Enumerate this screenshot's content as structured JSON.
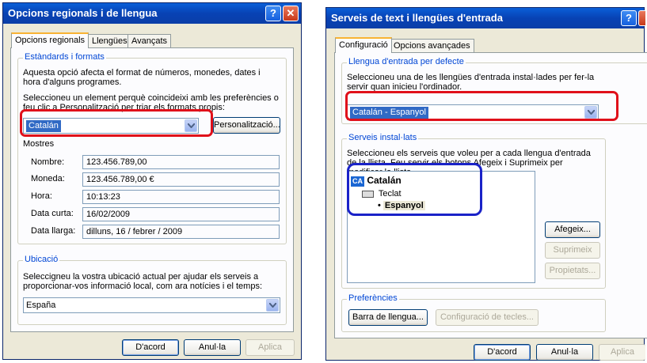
{
  "left_dialog": {
    "title": "Opcions regionals i de llengua",
    "help_glyph": "?",
    "close_glyph": "✕",
    "tabs": [
      "Opcions regionals",
      "Llengües",
      "Avançats"
    ],
    "standards_group": {
      "title": "Estàndards i formats",
      "desc": "Aquesta opció afecta el format de números, monedes, dates i hora d'alguns programes.",
      "instr": "Seleccioneu un element perquè coincideixi amb les preferències o feu clic a Personalització per triar els formats propis:",
      "format_value": "Catalán",
      "customize_label": "Personalització...",
      "samples_label": "Mostres",
      "samples": [
        {
          "label": "Nombre:",
          "value": "123.456.789,00"
        },
        {
          "label": "Moneda:",
          "value": "123.456.789,00 €"
        },
        {
          "label": "Hora:",
          "value": "10:13:23"
        },
        {
          "label": "Data curta:",
          "value": "16/02/2009"
        },
        {
          "label": "Data llarga:",
          "value": "dilluns, 16 / febrer / 2009"
        }
      ]
    },
    "location_group": {
      "title": "Ubicació",
      "desc": "Seleccigneu la vostra ubicació actual per ajudar els serveis a proporcionar-vos informació local, com ara notícies i el temps:",
      "value": "España"
    },
    "buttons": {
      "ok": "D'acord",
      "cancel": "Anul·la",
      "apply": "Aplica"
    }
  },
  "right_dialog": {
    "title": "Serveis de text i llengües d'entrada",
    "help_glyph": "?",
    "close_glyph": "✕",
    "tabs": [
      "Configuració",
      "Opcions avançades"
    ],
    "default_group": {
      "title": "Llengua d'entrada per defecte",
      "desc": "Seleccioneu una de les llengües d'entrada instal·lades per fer-la servir quan inicieu l'ordinador.",
      "value": "Catalán - Espanyol"
    },
    "services_group": {
      "title": "Serveis instal·lats",
      "desc": "Seleccioneu els serveis que voleu per a cada llengua d'entrada de la llista. Feu servir els botons Afegeix i Suprimeix per modificar la llista.",
      "tree": {
        "lang_badge": "CA",
        "lang": "Catalán",
        "category": "Teclat",
        "item": "Espanyol"
      },
      "add": "Afegeix...",
      "remove": "Suprimeix",
      "properties": "Propietats..."
    },
    "prefs_group": {
      "title": "Preferències",
      "langbar": "Barra de llengua...",
      "keys": "Configuració de tecles..."
    },
    "buttons": {
      "ok": "D'acord",
      "cancel": "Anul·la",
      "apply": "Aplica"
    }
  },
  "colors": {
    "highlight_red": "#e0101a",
    "highlight_blue": "#1a22c8",
    "titlebar": "#0842b4"
  }
}
